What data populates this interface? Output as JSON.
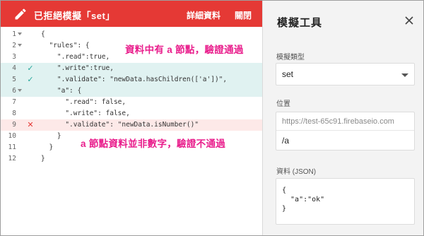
{
  "toolbar": {
    "title": "已拒絕模擬「set」",
    "detail_label": "詳細資料",
    "close_label": "關閉",
    "bg_color": "#e53935"
  },
  "editor": {
    "line_numbers": [
      "1",
      "2",
      "3",
      "4",
      "5",
      "6",
      "7",
      "8",
      "9",
      "10",
      "11",
      "12"
    ],
    "lines": [
      "{",
      "  \"rules\": {",
      "    \".read\":true,",
      "    \".write\":true,",
      "    \".validate\": \"newData.hasChildren(['a'])\",",
      "    \"a\": {",
      "      \".read\": false,",
      "      \".write\": false,",
      "      \".validate\": \"newData.isNumber()\"",
      "    }",
      "  }",
      "}"
    ],
    "pass_marker": "✓",
    "fail_marker": "✕",
    "pass_color": "#26a69a",
    "fail_color": "#e53935"
  },
  "annotations": {
    "pass_note": "資料中有 a 節點，驗證通過",
    "fail_note": "a 節點資料並非數字，驗證不通過",
    "color": "#e91e8c"
  },
  "sim": {
    "title": "模擬工具",
    "type_label": "模擬類型",
    "type_value": "set",
    "location_label": "位置",
    "location_prefix": "https://test-65c91.firebaseio.com",
    "location_value": "/a",
    "data_label": "資料 (JSON)",
    "data_value": "{\n  \"a\":\"ok\"\n}"
  }
}
